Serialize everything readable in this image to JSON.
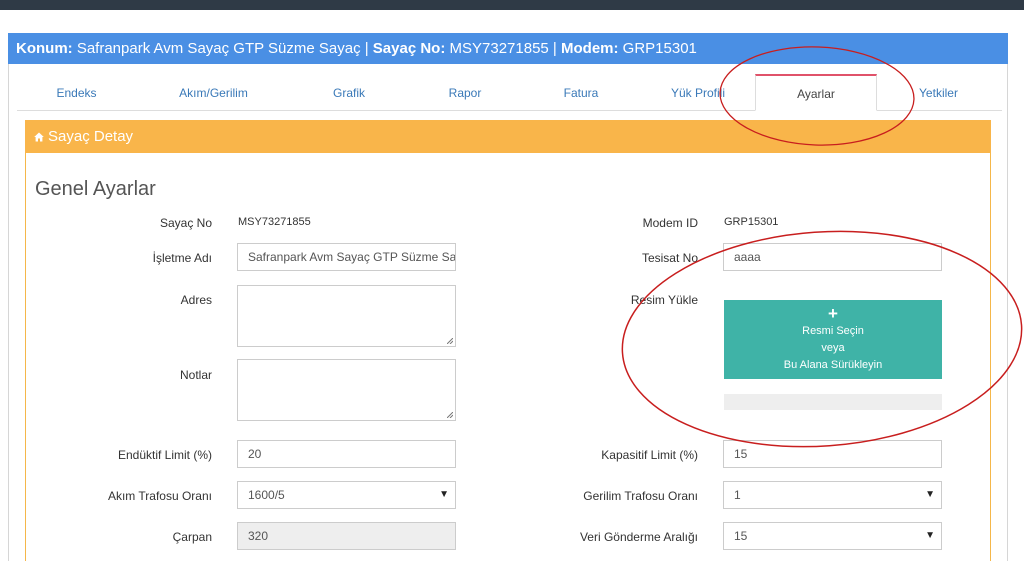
{
  "header": {
    "konum_label": "Konum:",
    "konum_value": " Safranpark Avm Sayaç GTP Süzme Sayaç | ",
    "sayac_label": "Sayaç No:",
    "sayac_value": " MSY73271855 | ",
    "modem_label": "Modem:",
    "modem_value": " GRP15301"
  },
  "tabs": [
    {
      "label": "Endeks"
    },
    {
      "label": "Akım/Gerilim"
    },
    {
      "label": "Grafik"
    },
    {
      "label": "Rapor"
    },
    {
      "label": "Fatura"
    },
    {
      "label": "Yük Profili"
    },
    {
      "label": "Ayarlar",
      "active": true
    },
    {
      "label": "Yetkiler"
    }
  ],
  "panel": {
    "title": "Sayaç Detay",
    "section_title": "Genel Ayarlar"
  },
  "form": {
    "sayac_no": {
      "label": "Sayaç No",
      "value": "MSY73271855"
    },
    "modem_id": {
      "label": "Modem ID",
      "value": "GRP15301"
    },
    "isletme_adi": {
      "label": "İşletme Adı",
      "value": "Safranpark Avm Sayaç GTP Süzme Sayaç"
    },
    "tesisat_no": {
      "label": "Tesisat No",
      "value": "aaaa"
    },
    "adres": {
      "label": "Adres",
      "value": ""
    },
    "resim_yukle": {
      "label": "Resim Yükle"
    },
    "notlar": {
      "label": "Notlar",
      "value": ""
    },
    "enduktif_limit": {
      "label": "Endüktif Limit (%)",
      "value": "20"
    },
    "kapasitif_limit": {
      "label": "Kapasitif Limit (%)",
      "value": "15"
    },
    "akim_trafosu": {
      "label": "Akım Trafosu Oranı",
      "value": "1600/5"
    },
    "gerilim_trafosu": {
      "label": "Gerilim Trafosu Oranı",
      "value": "1"
    },
    "carpan": {
      "label": "Çarpan",
      "value": "320"
    },
    "veri_gonderme": {
      "label": "Veri Gönderme Aralığı",
      "value": "15"
    }
  },
  "upload": {
    "line1": "Resmi Seçin",
    "line2": "veya",
    "line3": "Bu Alana Sürükleyin",
    "progress": 0
  },
  "colors": {
    "header": "#4a8fe4",
    "panel": "#f9b54a",
    "upload": "#3fb3a7",
    "active_tab": "#e0526a",
    "annotation": "#c81e1e"
  }
}
